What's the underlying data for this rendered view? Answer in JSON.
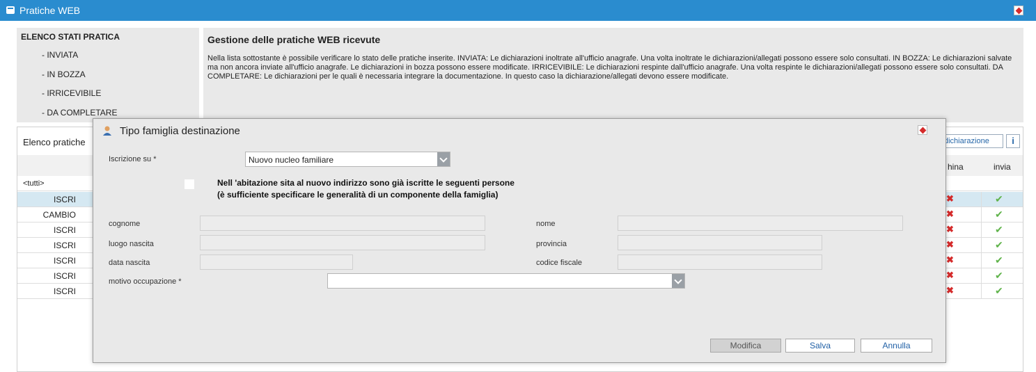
{
  "app": {
    "title": "Pratiche WEB"
  },
  "states": {
    "heading": "ELENCO STATI PRATICA",
    "items": [
      "-  INVIATA",
      "-  IN BOZZA",
      "-  IRRICEVIBILE",
      "-  DA COMPLETARE"
    ]
  },
  "info": {
    "heading": "Gestione delle pratiche WEB ricevute",
    "text": "Nella lista sottostante è possibile verificare lo stato delle pratiche inserite.       INVIATA: Le dichiarazioni inoltrate all'ufficio anagrafe. Una volta inoltrate le dichiarazioni/allegati possono essere solo consultati.       IN BOZZA: Le dichiarazioni salvate ma non ancora inviate all'ufficio anagrafe. Le dichiarazioni in bozza possono essere modificate.       IRRICEVIBILE: Le dichiarazioni respinte dall'ufficio anagrafe. Una volta respinte le dichiarazioni/allegati possono essere solo consultati.       DA COMPLETARE: Le dichiarazioni per le quali è necessaria integrare la documentazione. In questo caso la dichiarazione/allegati devono essere modificate."
  },
  "list": {
    "title": "Elenco pratiche",
    "declare_button": "dichiarazione",
    "col_elimina": "hina",
    "col_invia": "invia",
    "filter_all": "<tutti>",
    "rows": [
      "ISCRI",
      "CAMBIO",
      "ISCRI",
      "ISCRI",
      "ISCRI",
      "ISCRI",
      "ISCRI"
    ]
  },
  "modal": {
    "title": "Tipo famiglia destinazione",
    "iscrizione_label": "Iscrizione su *",
    "iscrizione_value": "Nuovo nucleo familiare",
    "note_line1": "Nell 'abitazione sita al nuovo indirizzo sono già iscritte le seguenti persone",
    "note_line2": "(è sufficiente specificare le generalità di un componente della famiglia)",
    "labels": {
      "cognome": "cognome",
      "nome": "nome",
      "luogo_nascita": "luogo nascita",
      "provincia": "provincia",
      "data_nascita": "data nascita",
      "codice_fiscale": "codice fiscale",
      "motivo": "motivo occupazione *"
    },
    "buttons": {
      "modifica": "Modifica",
      "salva": "Salva",
      "annulla": "Annulla"
    }
  },
  "colors": {
    "titlebar": "#2a8ccf",
    "panel": "#e9e9e9",
    "accent": "#1f5fa5",
    "error": "#d52b2b",
    "ok": "#5fb34a"
  }
}
